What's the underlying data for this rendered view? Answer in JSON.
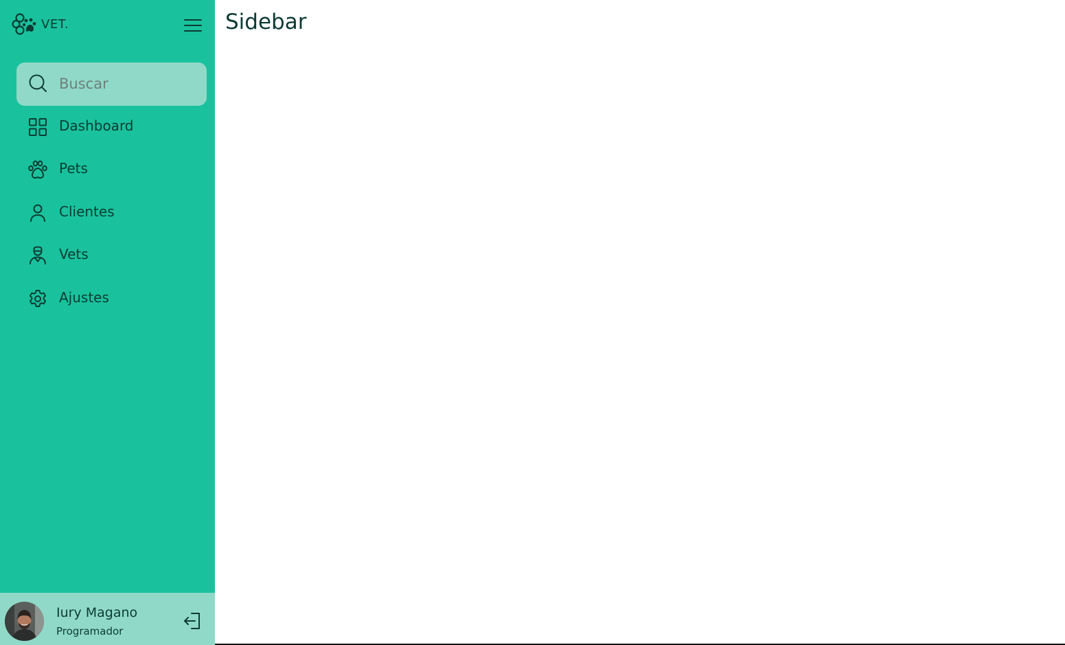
{
  "brand": {
    "logo_text": "VET."
  },
  "sidebar": {
    "search": {
      "placeholder": "Buscar",
      "value": ""
    },
    "items": [
      {
        "label": "Dashboard",
        "icon": "grid-icon"
      },
      {
        "label": "Pets",
        "icon": "paw-icon"
      },
      {
        "label": "Clientes",
        "icon": "user-icon"
      },
      {
        "label": "Vets",
        "icon": "vet-user-icon"
      },
      {
        "label": "Ajustes",
        "icon": "gear-icon"
      }
    ]
  },
  "user": {
    "name": "Iury Magano",
    "role": "Programador"
  },
  "main": {
    "title": "Sidebar"
  },
  "colors": {
    "sidebar_bg": "#19c29d",
    "search_bg": "#90d9c8",
    "text": "#0c3b33",
    "content_bg": "#ffffff"
  }
}
